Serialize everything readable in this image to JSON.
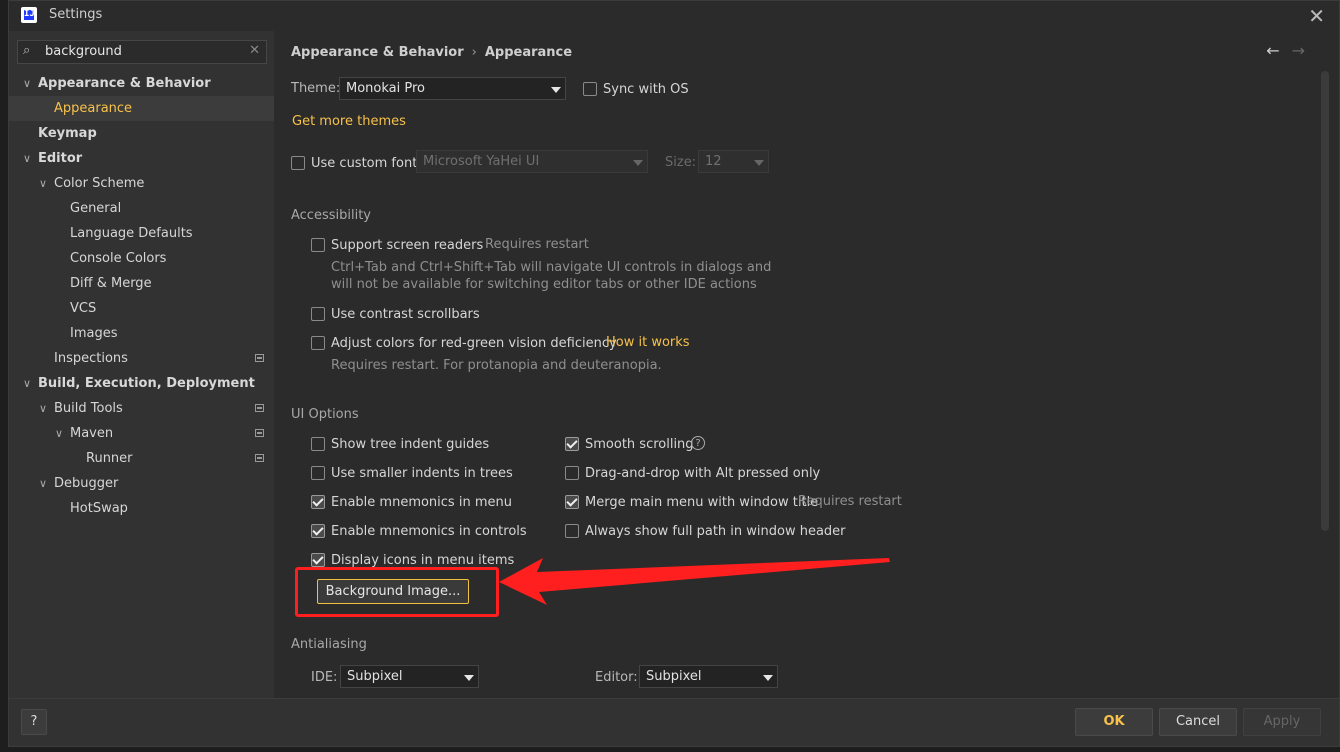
{
  "window": {
    "title": "Settings"
  },
  "search": {
    "value": "background"
  },
  "tree": [
    {
      "label": "Appearance & Behavior",
      "expanded": true,
      "bold": true
    },
    {
      "label": "Appearance",
      "selected": true
    },
    {
      "label": "Keymap",
      "bold": true
    },
    {
      "label": "Editor",
      "expanded": true,
      "bold": true
    },
    {
      "label": "Color Scheme",
      "expanded": true
    },
    {
      "label": "General"
    },
    {
      "label": "Language Defaults"
    },
    {
      "label": "Console Colors"
    },
    {
      "label": "Diff & Merge"
    },
    {
      "label": "VCS"
    },
    {
      "label": "Images"
    },
    {
      "label": "Inspections"
    },
    {
      "label": "Build, Execution, Deployment",
      "expanded": true,
      "bold": true
    },
    {
      "label": "Build Tools",
      "expanded": true
    },
    {
      "label": "Maven",
      "expanded": true
    },
    {
      "label": "Runner"
    },
    {
      "label": "Debugger",
      "expanded": true
    },
    {
      "label": "HotSwap"
    }
  ],
  "breadcrumb": {
    "parent": "Appearance & Behavior",
    "current": "Appearance"
  },
  "theme": {
    "label": "Theme:",
    "value": "Monokai Pro",
    "sync_label": "Sync with OS",
    "sync_checked": false,
    "more_themes": "Get more themes"
  },
  "font": {
    "label": "Use custom font:",
    "checked": false,
    "value": "Microsoft YaHei UI",
    "size_label": "Size:",
    "size_value": "12"
  },
  "accessibility": {
    "title": "Accessibility",
    "screen_readers": {
      "label": "Support screen readers",
      "note": "Requires restart",
      "checked": false
    },
    "screen_readers_desc1": "Ctrl+Tab and Ctrl+Shift+Tab will navigate UI controls in dialogs and",
    "screen_readers_desc2": "will not be available for switching editor tabs or other IDE actions",
    "contrast": {
      "label": "Use contrast scrollbars",
      "checked": false
    },
    "colors": {
      "label": "Adjust colors for red-green vision deficiency",
      "link": "How it works",
      "checked": false
    },
    "colors_desc": "Requires restart. For protanopia and deuteranopia."
  },
  "ui_options": {
    "title": "UI Options",
    "left": [
      {
        "label": "Show tree indent guides",
        "checked": false
      },
      {
        "label": "Use smaller indents in trees",
        "checked": false
      },
      {
        "label": "Enable mnemonics in menu",
        "checked": true
      },
      {
        "label": "Enable mnemonics in controls",
        "checked": true
      },
      {
        "label": "Display icons in menu items",
        "checked": true
      }
    ],
    "right": [
      {
        "label": "Smooth scrolling",
        "checked": true
      },
      {
        "label": "Drag-and-drop with Alt pressed only",
        "checked": false
      },
      {
        "label": "Merge main menu with window title",
        "checked": true,
        "note": "Requires restart"
      },
      {
        "label": "Always show full path in window header",
        "checked": false
      }
    ],
    "background_button": "Background Image..."
  },
  "antialiasing": {
    "title": "Antialiasing",
    "ide_label": "IDE:",
    "ide_value": "Subpixel",
    "editor_label": "Editor:",
    "editor_value": "Subpixel"
  },
  "footer": {
    "help": "?",
    "ok": "OK",
    "cancel": "Cancel",
    "apply": "Apply"
  },
  "colors": {
    "accent": "#f7c14a",
    "annotation": "#ff1f1f"
  }
}
